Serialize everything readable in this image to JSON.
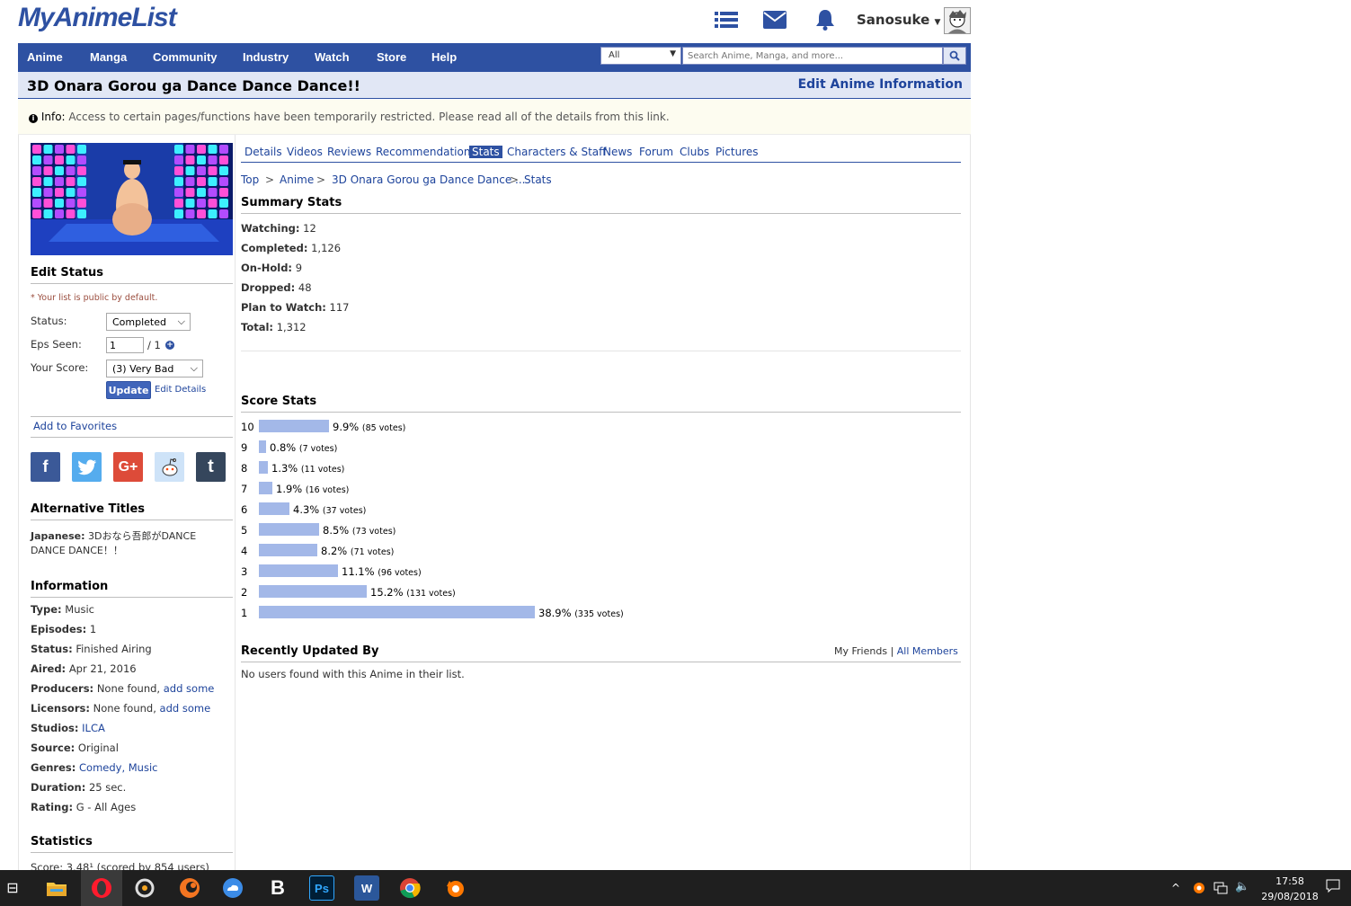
{
  "header": {
    "logo": "MyAnimeList",
    "username": "Sanosuke"
  },
  "nav": {
    "items": [
      "Anime",
      "Manga",
      "Community",
      "Industry",
      "Watch",
      "Store",
      "Help"
    ],
    "search_type": "All",
    "search_placeholder": "Search Anime, Manga, and more..."
  },
  "title": {
    "name": "3D Onara Gorou ga Dance Dance Dance!!",
    "edit_link": "Edit Anime Information"
  },
  "info": {
    "label": "Info:",
    "message": "Access to certain pages/functions have been temporarily restricted. Please read all of the details from this link."
  },
  "edit_status": {
    "heading": "Edit Status",
    "public_note": "* Your list is public by default.",
    "status_label": "Status:",
    "status_value": "Completed",
    "eps_label": "Eps Seen:",
    "eps_value": "1",
    "eps_total": "/ 1",
    "score_label": "Your Score:",
    "score_value": "(3) Very Bad",
    "update_btn": "Update",
    "edit_details": "Edit Details",
    "add_favorites": "Add to Favorites"
  },
  "alt_titles": {
    "heading": "Alternative Titles",
    "japanese_label": "Japanese:",
    "japanese_value_line1": "3Dおなら吾郎がDANCE",
    "japanese_value_line2": "DANCE DANCE！！"
  },
  "information": {
    "heading": "Information",
    "rows": [
      {
        "label": "Type:",
        "value": "Music",
        "link": ""
      },
      {
        "label": "Episodes:",
        "value": "1",
        "link": ""
      },
      {
        "label": "Status:",
        "value": "Finished Airing",
        "link": ""
      },
      {
        "label": "Aired:",
        "value": "Apr 21, 2016",
        "link": ""
      },
      {
        "label": "Producers:",
        "value": "None found,",
        "link": "add some"
      },
      {
        "label": "Licensors:",
        "value": "None found,",
        "link": "add some"
      },
      {
        "label": "Studios:",
        "value": "",
        "link": "ILCA"
      },
      {
        "label": "Source:",
        "value": "Original",
        "link": ""
      },
      {
        "label": "Genres:",
        "value": "",
        "link": "Comedy, Music"
      },
      {
        "label": "Duration:",
        "value": "25 sec.",
        "link": ""
      },
      {
        "label": "Rating:",
        "value": "G - All Ages",
        "link": ""
      }
    ]
  },
  "statistics": {
    "heading": "Statistics",
    "score_line": "Score: 3.48¹ (scored by 854 users)"
  },
  "tabs": [
    "Details",
    "Videos",
    "Reviews",
    "Recommendations",
    "Stats",
    "Characters & Staff",
    "News",
    "Forum",
    "Clubs",
    "Pictures"
  ],
  "active_tab": "Stats",
  "breadcrumb": [
    "Top",
    "Anime",
    "3D Onara Gorou ga Dance Dance ...",
    "Stats"
  ],
  "breadcrumb_sep": ">",
  "summary": {
    "heading": "Summary Stats",
    "rows": [
      {
        "label": "Watching:",
        "value": "12"
      },
      {
        "label": "Completed:",
        "value": "1,126"
      },
      {
        "label": "On-Hold:",
        "value": "9"
      },
      {
        "label": "Dropped:",
        "value": "48"
      },
      {
        "label": "Plan to Watch:",
        "value": "117"
      },
      {
        "label": "Total:",
        "value": "1,312"
      }
    ]
  },
  "score_stats": {
    "heading": "Score Stats",
    "rows": [
      {
        "score": "10",
        "percent": 9.9,
        "pct_text": "9.9%",
        "votes": "(85 votes)"
      },
      {
        "score": "9",
        "percent": 0.8,
        "pct_text": "0.8%",
        "votes": "(7 votes)"
      },
      {
        "score": "8",
        "percent": 1.3,
        "pct_text": "1.3%",
        "votes": "(11 votes)"
      },
      {
        "score": "7",
        "percent": 1.9,
        "pct_text": "1.9%",
        "votes": "(16 votes)"
      },
      {
        "score": "6",
        "percent": 4.3,
        "pct_text": "4.3%",
        "votes": "(37 votes)"
      },
      {
        "score": "5",
        "percent": 8.5,
        "pct_text": "8.5%",
        "votes": "(73 votes)"
      },
      {
        "score": "4",
        "percent": 8.2,
        "pct_text": "8.2%",
        "votes": "(71 votes)"
      },
      {
        "score": "3",
        "percent": 11.1,
        "pct_text": "11.1%",
        "votes": "(96 votes)"
      },
      {
        "score": "2",
        "percent": 15.2,
        "pct_text": "15.2%",
        "votes": "(131 votes)"
      },
      {
        "score": "1",
        "percent": 38.9,
        "pct_text": "38.9%",
        "votes": "(335 votes)"
      }
    ]
  },
  "recent": {
    "heading": "Recently Updated By",
    "my_friends": "My Friends",
    "pipe": "|",
    "all_members": "All Members",
    "empty": "No users found with this Anime in their list."
  },
  "taskbar": {
    "time": "17:58",
    "date": "29/08/2018",
    "apps": [
      "opera",
      "app",
      "crunchyroll",
      "cloud",
      "B",
      "Ps",
      "W",
      "chrome",
      "avast"
    ]
  },
  "colors": {
    "brand": "#2e51a2",
    "bar": "#a3b8e8",
    "title_bg": "#e1e7f5",
    "link": "#1d439b"
  }
}
